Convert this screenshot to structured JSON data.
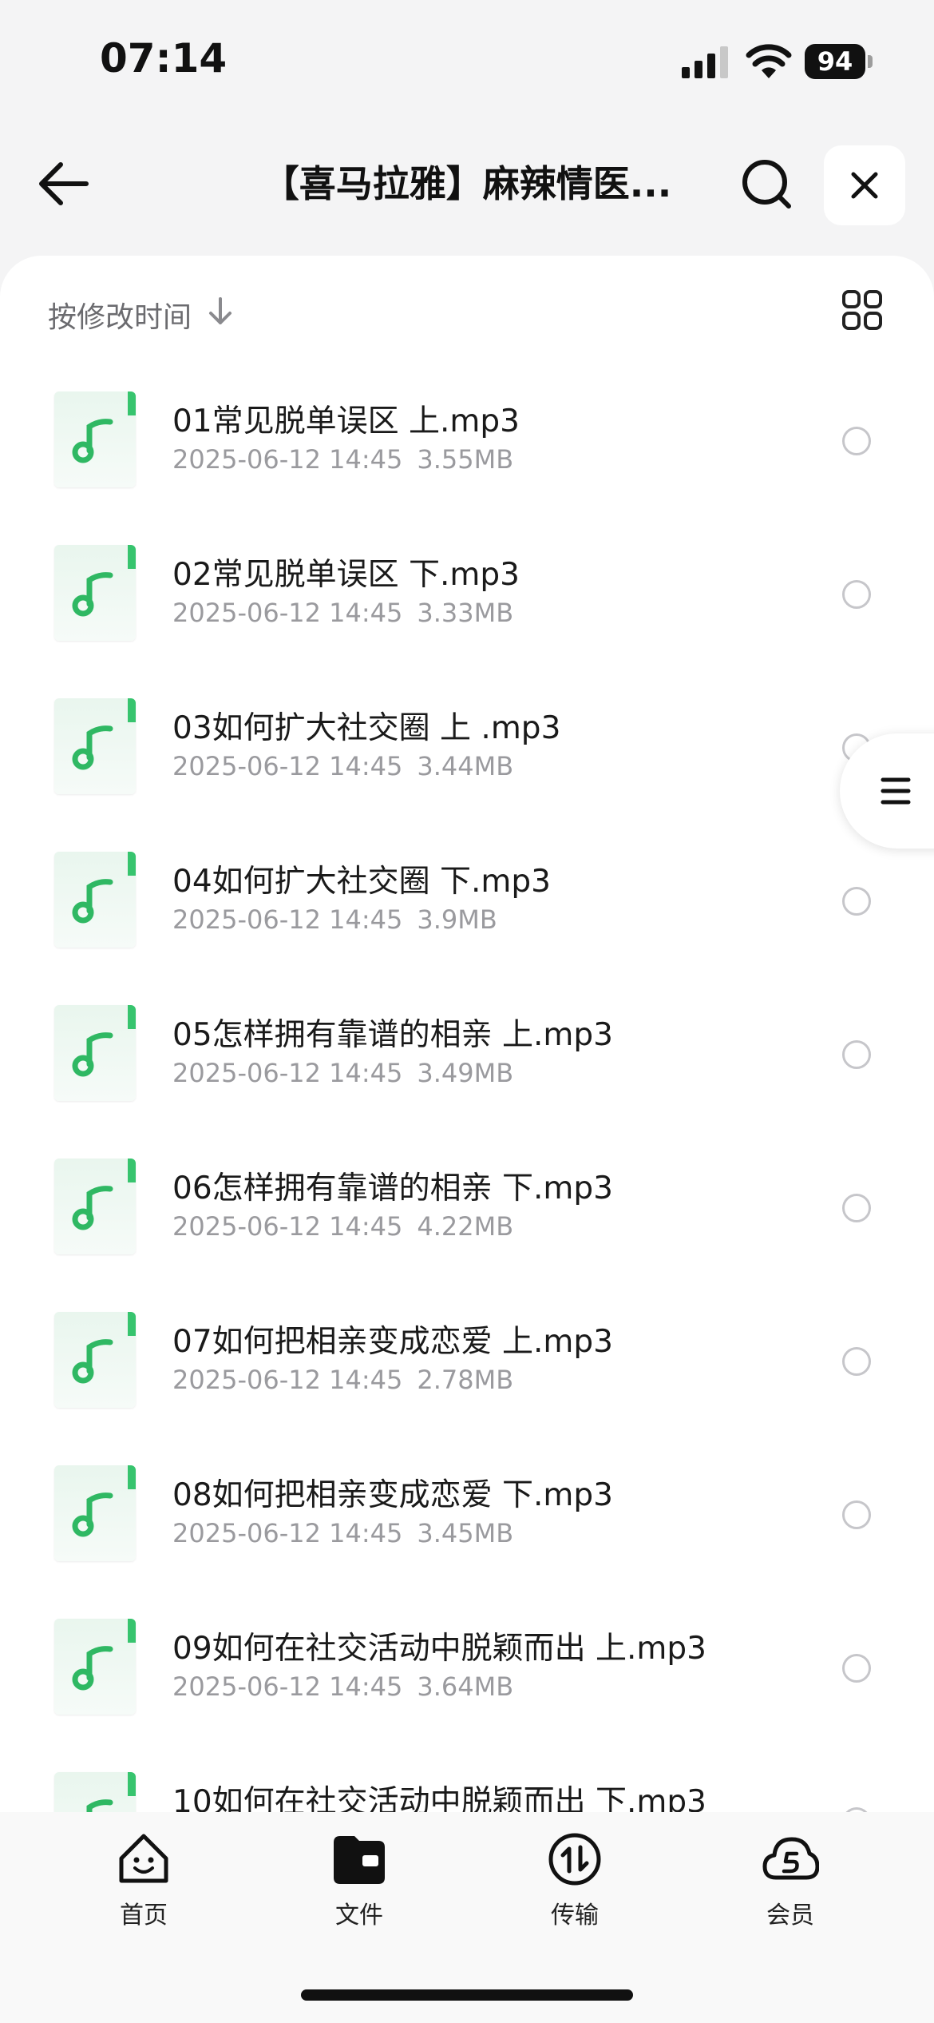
{
  "status_bar": {
    "time": "07:14",
    "battery": "94"
  },
  "header": {
    "title": "【喜马拉雅】麻辣情医..."
  },
  "toolbar": {
    "sort_label": "按修改时间"
  },
  "files": [
    {
      "name": "01常见脱单误区 上.mp3",
      "date": "2025-06-12 14:45",
      "size": "3.55MB"
    },
    {
      "name": "02常见脱单误区 下.mp3",
      "date": "2025-06-12 14:45",
      "size": "3.33MB"
    },
    {
      "name": "03如何扩大社交圈 上 .mp3",
      "date": "2025-06-12 14:45",
      "size": "3.44MB"
    },
    {
      "name": "04如何扩大社交圈 下.mp3",
      "date": "2025-06-12 14:45",
      "size": "3.9MB"
    },
    {
      "name": "05怎样拥有靠谱的相亲 上.mp3",
      "date": "2025-06-12 14:45",
      "size": "3.49MB"
    },
    {
      "name": "06怎样拥有靠谱的相亲 下.mp3",
      "date": "2025-06-12 14:45",
      "size": "4.22MB"
    },
    {
      "name": "07如何把相亲变成恋爱 上.mp3",
      "date": "2025-06-12 14:45",
      "size": "2.78MB"
    },
    {
      "name": "08如何把相亲变成恋爱 下.mp3",
      "date": "2025-06-12 14:45",
      "size": "3.45MB"
    },
    {
      "name": "09如何在社交活动中脱颖而出 上.mp3",
      "date": "2025-06-12 14:45",
      "size": "3.64MB"
    },
    {
      "name": "10如何在社交活动中脱颖而出 下.mp3",
      "date": "",
      "size": ""
    }
  ],
  "tabs": [
    {
      "label": "首页",
      "icon": "smiley-home-icon"
    },
    {
      "label": "文件",
      "icon": "folder-icon"
    },
    {
      "label": "传输",
      "icon": "transfer-icon"
    },
    {
      "label": "会员",
      "icon": "cloud-member-icon"
    }
  ],
  "colors": {
    "accent_green": "#37c46e",
    "background": "#f4f4f5"
  }
}
